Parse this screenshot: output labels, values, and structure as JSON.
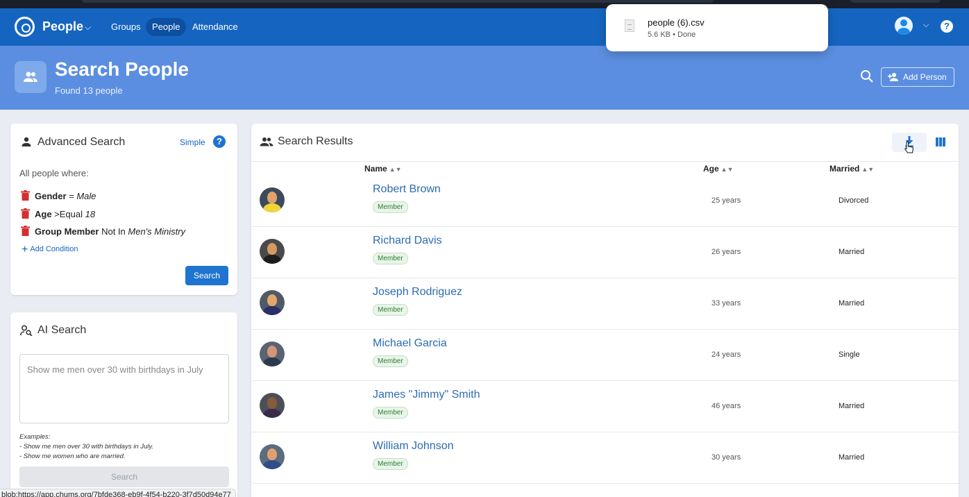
{
  "nav": {
    "app_title": "People",
    "links": [
      "Groups",
      "People",
      "Attendance"
    ],
    "active": "People"
  },
  "download": {
    "file_name": "people (6).csv",
    "status": "5.6 KB • Done"
  },
  "header": {
    "title": "Search People",
    "subtitle": "Found 13 people",
    "add_person_label": "Add Person"
  },
  "advanced": {
    "title": "Advanced Search",
    "simple_link": "Simple",
    "intro": "All people where:",
    "conditions": [
      {
        "field": "Gender",
        "op": " = ",
        "value": "Male"
      },
      {
        "field": "Age",
        "op": " >Equal ",
        "value": "18"
      },
      {
        "field": "Group Member",
        "op": " Not In ",
        "value": "Men's Ministry"
      }
    ],
    "add_condition_label": "Add Condition",
    "search_label": "Search"
  },
  "ai": {
    "title": "AI Search",
    "placeholder": "Show me men over 30 with birthdays in July",
    "examples_heading": "Examples:",
    "examples": [
      "- Show me men over 30 with birthdays in July.",
      "- Show me women who are married."
    ],
    "search_label": "Search"
  },
  "results": {
    "title": "Search Results",
    "columns": {
      "name": "Name",
      "age": "Age",
      "married": "Married"
    },
    "rows": [
      {
        "name": "Robert Brown",
        "badge": "Member",
        "age": "25 years",
        "married": "Divorced"
      },
      {
        "name": "Richard Davis",
        "badge": "Member",
        "age": "26 years",
        "married": "Married"
      },
      {
        "name": "Joseph Rodriguez",
        "badge": "Member",
        "age": "33 years",
        "married": "Married"
      },
      {
        "name": "Michael Garcia",
        "badge": "Member",
        "age": "24 years",
        "married": "Single"
      },
      {
        "name": "James \"Jimmy\" Smith",
        "badge": "Member",
        "age": "46 years",
        "married": "Married"
      },
      {
        "name": "William Johnson",
        "badge": "Member",
        "age": "30 years",
        "married": "Married"
      }
    ]
  },
  "status_bar": "blob:https://app.chums.org/7bfde368-eb9f-4f54-b220-3f7d50d94e77",
  "colors": {
    "nav_bg": "#1565c0",
    "header_bg": "#5b8ee0",
    "accent": "#1e74d0",
    "delete_red": "#d32f2f",
    "member_green": "#2e7d32"
  }
}
